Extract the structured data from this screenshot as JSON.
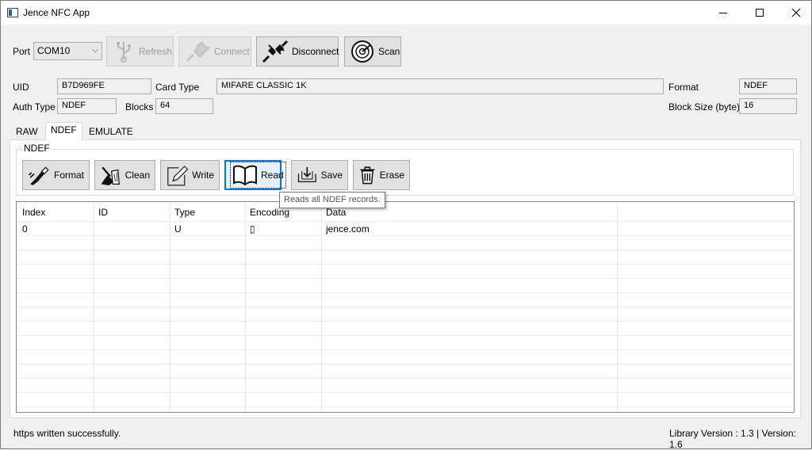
{
  "window": {
    "title": "Jence NFC App"
  },
  "toolbar": {
    "port_label": "Port",
    "port_value": "COM10",
    "buttons": [
      {
        "label": "Refresh",
        "icon": "usb-icon",
        "enabled": false
      },
      {
        "label": "Connect",
        "icon": "plug-icon",
        "enabled": false
      },
      {
        "label": "Disconnect",
        "icon": "unplug-icon",
        "enabled": true
      },
      {
        "label": "Scan",
        "icon": "radar-icon",
        "enabled": true
      }
    ]
  },
  "card": {
    "uid_label": "UID",
    "uid_value": "B7D969FE",
    "card_type_label": "Card Type",
    "card_type_value": "MIFARE CLASSIC 1K",
    "format_label": "Format",
    "format_value": "NDEF",
    "auth_type_label": "Auth Type",
    "auth_type_value": "NDEF",
    "blocks_label": "Blocks",
    "blocks_value": "64",
    "block_size_label": "Block Size (byte)",
    "block_size_value": "16"
  },
  "tabs": [
    {
      "label": "RAW",
      "active": false
    },
    {
      "label": "NDEF",
      "active": true
    },
    {
      "label": "EMULATE",
      "active": false
    }
  ],
  "ndef": {
    "group_title": "NDEF",
    "buttons": [
      {
        "label": "Format",
        "icon": "paint-brush-icon"
      },
      {
        "label": "Clean",
        "icon": "broom-icon"
      },
      {
        "label": "Write",
        "icon": "pencil-icon"
      },
      {
        "label": "Read",
        "icon": "open-book-icon"
      },
      {
        "label": "Save",
        "icon": "save-tray-icon"
      },
      {
        "label": "Erase",
        "icon": "trash-icon"
      }
    ],
    "tooltip": "Reads all NDEF records."
  },
  "table": {
    "columns": [
      "Index",
      "ID",
      "Type",
      "Encoding",
      "Data"
    ],
    "rows": [
      {
        "index": "0",
        "id": "",
        "type": "U",
        "encoding": "▯",
        "data": "jence.com"
      }
    ]
  },
  "status": {
    "message": "https written successfully.",
    "version": "Library Version : 1.3 | Version: 1.6"
  }
}
